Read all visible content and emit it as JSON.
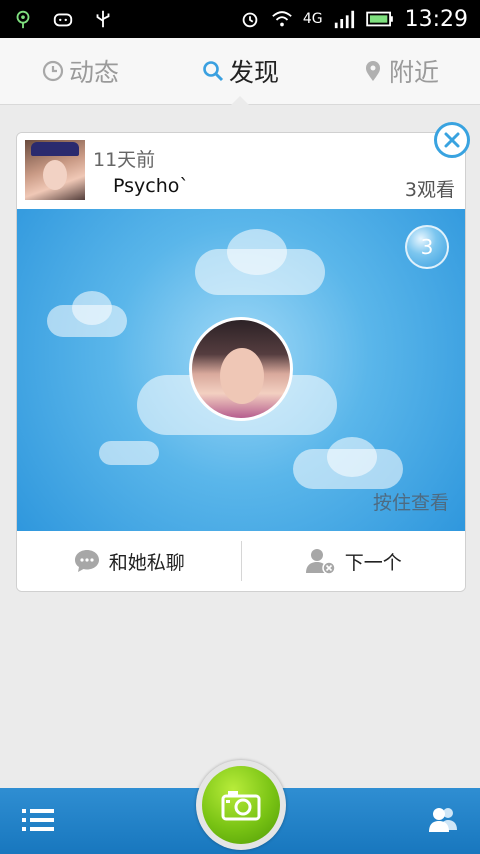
{
  "status_bar": {
    "time": "13:29",
    "network": "4G",
    "icons": [
      "location-icon",
      "android-icon",
      "usb-icon",
      "alarm-icon",
      "wifi-icon",
      "signal-icon",
      "battery-icon"
    ]
  },
  "tabs": [
    {
      "label": "动态",
      "icon": "clock-icon",
      "active": false
    },
    {
      "label": "发现",
      "icon": "search-icon",
      "active": true
    },
    {
      "label": "附近",
      "icon": "location-pin-icon",
      "active": false
    }
  ],
  "card": {
    "time_ago": "11天前",
    "nickname": "Psycho`",
    "views": "3观看",
    "view_count_badge": "3",
    "hold_to_view": "按住查看",
    "chat_button": "和她私聊",
    "next_button": "下一个"
  },
  "colors": {
    "accent": "#39a3e0",
    "bottom_bar": "#1f80c6",
    "camera": "#79c314"
  }
}
